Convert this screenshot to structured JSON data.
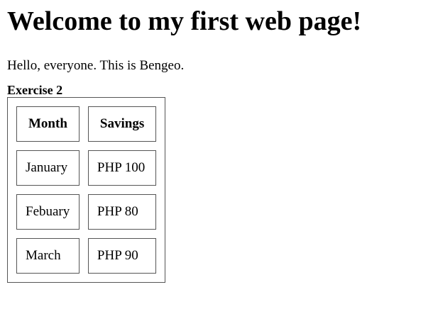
{
  "heading": "Welcome to my first web page!",
  "intro": "Hello, everyone. This is Bengeo.",
  "table": {
    "caption": "Exercise 2",
    "headers": [
      "Month",
      "Savings"
    ],
    "rows": [
      [
        "January",
        "PHP 100"
      ],
      [
        "Febuary",
        "PHP 80"
      ],
      [
        "March",
        "PHP 90"
      ]
    ]
  }
}
